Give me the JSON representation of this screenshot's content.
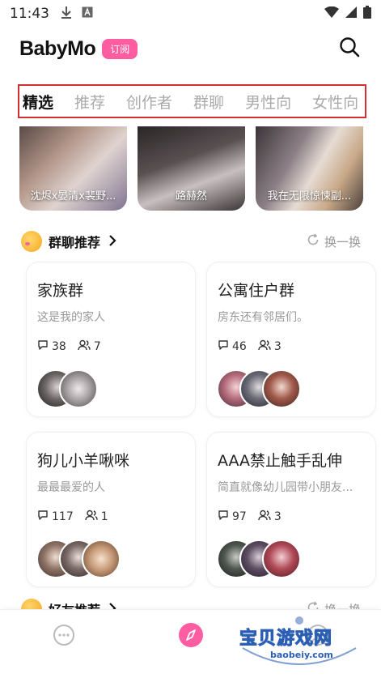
{
  "status_bar": {
    "time": "11:43"
  },
  "header": {
    "logo": "BabyMo",
    "subscribe_badge": "订阅"
  },
  "tabs": [
    {
      "label": "精选",
      "active": true
    },
    {
      "label": "推荐",
      "active": false
    },
    {
      "label": "创作者",
      "active": false
    },
    {
      "label": "群聊",
      "active": false
    },
    {
      "label": "男性向",
      "active": false
    },
    {
      "label": "女性向",
      "active": false
    }
  ],
  "creators": [
    {
      "name": "沈烬x晏清x裴野..."
    },
    {
      "name": "路赫然"
    },
    {
      "name": "我在无限惊悚副..."
    }
  ],
  "group_section": {
    "title": "群聊推荐",
    "refresh_label": "换一换"
  },
  "groups": [
    {
      "name": "家族群",
      "desc": "这是我的家人",
      "messages": "38",
      "members": "7"
    },
    {
      "name": "公寓住户群",
      "desc": "房东还有邻居们。",
      "messages": "46",
      "members": "3"
    },
    {
      "name": "狗儿小羊啾咪",
      "desc": "最最最爱的人",
      "messages": "117",
      "members": "1"
    },
    {
      "name": "AAA禁止触手乱伸",
      "desc": "简直就像幼儿园带小朋友...",
      "messages": "97",
      "members": "3"
    }
  ],
  "friend_section": {
    "title": "好友推荐",
    "refresh_label": "换一换"
  },
  "watermark": {
    "title": "宝贝游戏网",
    "url": "baobeiy.com"
  },
  "colors": {
    "accent": "#ff5da2",
    "tab_border": "#d32f2f"
  },
  "icons": [
    "download-icon",
    "a-icon",
    "wifi-icon",
    "signal-icon",
    "battery-icon",
    "search-icon",
    "refresh-icon",
    "comment-icon",
    "members-icon",
    "chat-nav-icon",
    "discover-nav-icon",
    "profile-nav-icon"
  ]
}
